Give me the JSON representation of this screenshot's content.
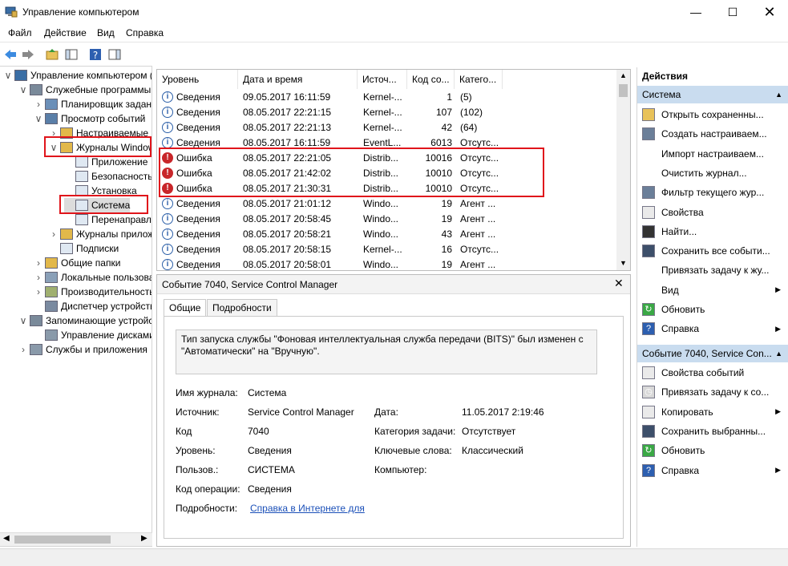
{
  "window": {
    "title": "Управление компьютером"
  },
  "menu": [
    "Файл",
    "Действие",
    "Вид",
    "Справка"
  ],
  "tree": [
    {
      "label": "Управление компьютером (л",
      "indent": 0,
      "exp": "v"
    },
    {
      "label": "Служебные программы",
      "indent": 1,
      "exp": "v"
    },
    {
      "label": "Планировщик заданий",
      "indent": 2,
      "exp": ">"
    },
    {
      "label": "Просмотр событий",
      "indent": 2,
      "exp": "v"
    },
    {
      "label": "Настраиваемые пр",
      "indent": 3,
      "exp": ">"
    },
    {
      "label": "Журналы Windows",
      "indent": 3,
      "exp": "v"
    },
    {
      "label": "Приложение",
      "indent": 4,
      "exp": ""
    },
    {
      "label": "Безопасность",
      "indent": 4,
      "exp": ""
    },
    {
      "label": "Установка",
      "indent": 4,
      "exp": ""
    },
    {
      "label": "Система",
      "indent": 4,
      "exp": ""
    },
    {
      "label": "Перенаправлен",
      "indent": 4,
      "exp": ""
    },
    {
      "label": "Журналы приложе",
      "indent": 3,
      "exp": ">"
    },
    {
      "label": "Подписки",
      "indent": 3,
      "exp": ""
    },
    {
      "label": "Общие папки",
      "indent": 2,
      "exp": ">"
    },
    {
      "label": "Локальные пользовате",
      "indent": 2,
      "exp": ">"
    },
    {
      "label": "Производительность",
      "indent": 2,
      "exp": ">"
    },
    {
      "label": "Диспетчер устройств",
      "indent": 2,
      "exp": ""
    },
    {
      "label": "Запоминающие устройства",
      "indent": 1,
      "exp": "v"
    },
    {
      "label": "Управление дисками",
      "indent": 2,
      "exp": ""
    },
    {
      "label": "Службы и приложения",
      "indent": 1,
      "exp": ">"
    }
  ],
  "list": {
    "columns": [
      "Уровень",
      "Дата и время",
      "Источ...",
      "Код со...",
      "Катего..."
    ],
    "rows": [
      {
        "level": "Сведения",
        "type": "info",
        "date": "09.05.2017 16:11:59",
        "source": "Kernel-...",
        "code": "1",
        "cat": "(5)"
      },
      {
        "level": "Сведения",
        "type": "info",
        "date": "08.05.2017 22:21:15",
        "source": "Kernel-...",
        "code": "107",
        "cat": "(102)"
      },
      {
        "level": "Сведения",
        "type": "info",
        "date": "08.05.2017 22:21:13",
        "source": "Kernel-...",
        "code": "42",
        "cat": "(64)"
      },
      {
        "level": "Сведения",
        "type": "info",
        "date": "08.05.2017 16:11:59",
        "source": "EventL...",
        "code": "6013",
        "cat": "Отсутс..."
      },
      {
        "level": "Ошибка",
        "type": "error",
        "date": "08.05.2017 22:21:05",
        "source": "Distrib...",
        "code": "10016",
        "cat": "Отсутс..."
      },
      {
        "level": "Ошибка",
        "type": "error",
        "date": "08.05.2017 21:42:02",
        "source": "Distrib...",
        "code": "10010",
        "cat": "Отсутс..."
      },
      {
        "level": "Ошибка",
        "type": "error",
        "date": "08.05.2017 21:30:31",
        "source": "Distrib...",
        "code": "10010",
        "cat": "Отсутс..."
      },
      {
        "level": "Сведения",
        "type": "info",
        "date": "08.05.2017 21:01:12",
        "source": "Windo...",
        "code": "19",
        "cat": "Агент ..."
      },
      {
        "level": "Сведения",
        "type": "info",
        "date": "08.05.2017 20:58:45",
        "source": "Windo...",
        "code": "19",
        "cat": "Агент ..."
      },
      {
        "level": "Сведения",
        "type": "info",
        "date": "08.05.2017 20:58:21",
        "source": "Windo...",
        "code": "43",
        "cat": "Агент ..."
      },
      {
        "level": "Сведения",
        "type": "info",
        "date": "08.05.2017 20:58:15",
        "source": "Kernel-...",
        "code": "16",
        "cat": "Отсутс..."
      },
      {
        "level": "Сведения",
        "type": "info",
        "date": "08.05.2017 20:58:01",
        "source": "Windo...",
        "code": "19",
        "cat": "Агент ..."
      }
    ]
  },
  "detail": {
    "header": "Событие 7040, Service Control Manager",
    "tabs": [
      "Общие",
      "Подробности"
    ],
    "description": "Тип запуска службы \"Фоновая интеллектуальная служба передачи (BITS)\" был изменен с \"Автоматически\" на \"Вручную\".",
    "fields": {
      "log_label": "Имя журнала:",
      "log_value": "Система",
      "source_label": "Источник:",
      "source_value": "Service Control Manager",
      "date_label": "Дата:",
      "date_value": "11.05.2017 2:19:46",
      "code_label": "Код",
      "code_value": "7040",
      "task_label": "Категория задачи:",
      "task_value": "Отсутствует",
      "level_label": "Уровень:",
      "level_value": "Сведения",
      "keywords_label": "Ключевые слова:",
      "keywords_value": "Классический",
      "user_label": "Пользов.:",
      "user_value": "СИСТЕМА",
      "computer_label": "Компьютер:",
      "computer_value": "",
      "opcode_label": "Код операции:",
      "opcode_value": "Сведения",
      "more_label": "Подробности:",
      "more_link": "Справка в Интернете для"
    }
  },
  "actions": {
    "title": "Действия",
    "group1": "Система",
    "items1": [
      {
        "label": "Открыть сохраненны...",
        "icon": "folder-open-icon",
        "arrow": false
      },
      {
        "label": "Создать настраиваем...",
        "icon": "filter-icon",
        "arrow": false
      },
      {
        "label": "Импорт настраиваем...",
        "icon": "blank-icon",
        "arrow": false
      },
      {
        "label": "Очистить журнал...",
        "icon": "blank-icon",
        "arrow": false
      },
      {
        "label": "Фильтр текущего жур...",
        "icon": "filter-icon",
        "arrow": false
      },
      {
        "label": "Свойства",
        "icon": "properties-icon",
        "arrow": false
      },
      {
        "label": "Найти...",
        "icon": "binoculars-icon",
        "arrow": false
      },
      {
        "label": "Сохранить все событи...",
        "icon": "save-icon",
        "arrow": false
      },
      {
        "label": "Привязать задачу к жу...",
        "icon": "blank-icon",
        "arrow": false
      },
      {
        "label": "Вид",
        "icon": "blank-icon",
        "arrow": true
      },
      {
        "label": "Обновить",
        "icon": "refresh-icon",
        "arrow": false
      },
      {
        "label": "Справка",
        "icon": "help-icon",
        "arrow": true
      }
    ],
    "group2": "Событие 7040, Service Con...",
    "items2": [
      {
        "label": "Свойства событий",
        "icon": "properties-icon",
        "arrow": false
      },
      {
        "label": "Привязать задачу к со...",
        "icon": "task-icon",
        "arrow": false
      },
      {
        "label": "Копировать",
        "icon": "copy-icon",
        "arrow": true
      },
      {
        "label": "Сохранить выбранны...",
        "icon": "save-icon",
        "arrow": false
      },
      {
        "label": "Обновить",
        "icon": "refresh-icon",
        "arrow": false
      },
      {
        "label": "Справка",
        "icon": "help-icon",
        "arrow": true
      }
    ]
  }
}
